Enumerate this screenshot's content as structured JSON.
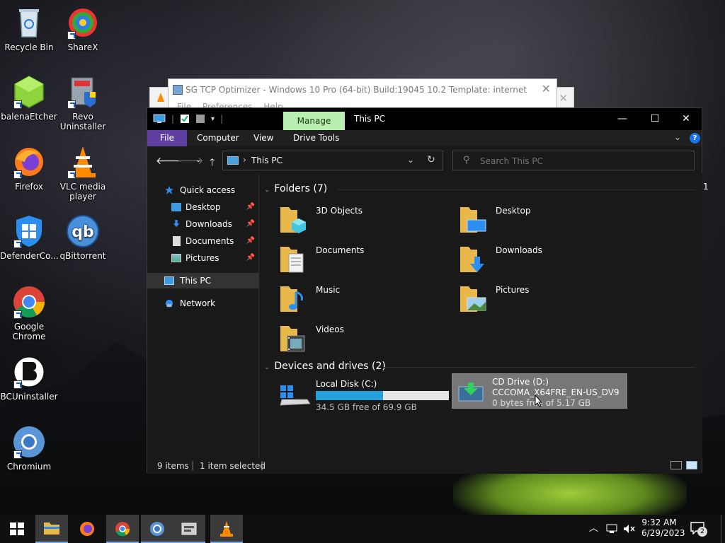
{
  "desktop": {
    "icons": [
      {
        "label": "Recycle Bin"
      },
      {
        "label": "ShareX"
      },
      {
        "label": "balenaEtcher"
      },
      {
        "label": "Revo Uninstaller"
      },
      {
        "label": "Firefox"
      },
      {
        "label": "VLC media player"
      },
      {
        "label": "DefenderCo..."
      },
      {
        "label": "qBittorrent"
      },
      {
        "label": "Google Chrome"
      },
      {
        "label": "BCUninstaller"
      },
      {
        "label": "Chromium"
      }
    ],
    "stray_text": "1"
  },
  "tcp_window": {
    "title": "SG TCP Optimizer - Windows 10 Pro (64-bit) Build:19045 10.2  Template: internet",
    "menu_file": "File",
    "menu_preferences": "Preferences",
    "menu_help": "Help"
  },
  "explorer": {
    "title": "This PC",
    "manage_tab": "Manage",
    "ribbon": {
      "file": "File",
      "computer": "Computer",
      "view": "View",
      "drive_tools": "Drive Tools"
    },
    "address": {
      "path": "This PC"
    },
    "search": {
      "placeholder": "Search This PC"
    },
    "nav": {
      "quick_access": "Quick access",
      "desktop": "Desktop",
      "downloads": "Downloads",
      "documents": "Documents",
      "pictures": "Pictures",
      "this_pc": "This PC",
      "network": "Network"
    },
    "folders_header": "Folders (7)",
    "folders": [
      {
        "name": "3D Objects"
      },
      {
        "name": "Desktop"
      },
      {
        "name": "Documents"
      },
      {
        "name": "Downloads"
      },
      {
        "name": "Music"
      },
      {
        "name": "Pictures"
      },
      {
        "name": "Videos"
      }
    ],
    "devices_header": "Devices and drives (2)",
    "drives": [
      {
        "name": "Local Disk (C:)",
        "free_text": "34.5 GB free of 69.9 GB",
        "used_fraction": 0.506
      },
      {
        "name": "CD Drive (D:)",
        "label": "CCCOMA_X64FRE_EN-US_DV9",
        "free_text": "0 bytes free of 5.17 GB"
      }
    ],
    "status": {
      "items": "9 items",
      "selected": "1 item selected"
    }
  },
  "taskbar": {
    "time": "9:32 AM",
    "date": "6/29/2023",
    "notifications": "2"
  },
  "colors": {
    "accent_file_tab": "#5f3f9f",
    "manage_tab": "#b7f0b0",
    "drive_bar": "#26a0da",
    "selected_drive": "#777777"
  }
}
